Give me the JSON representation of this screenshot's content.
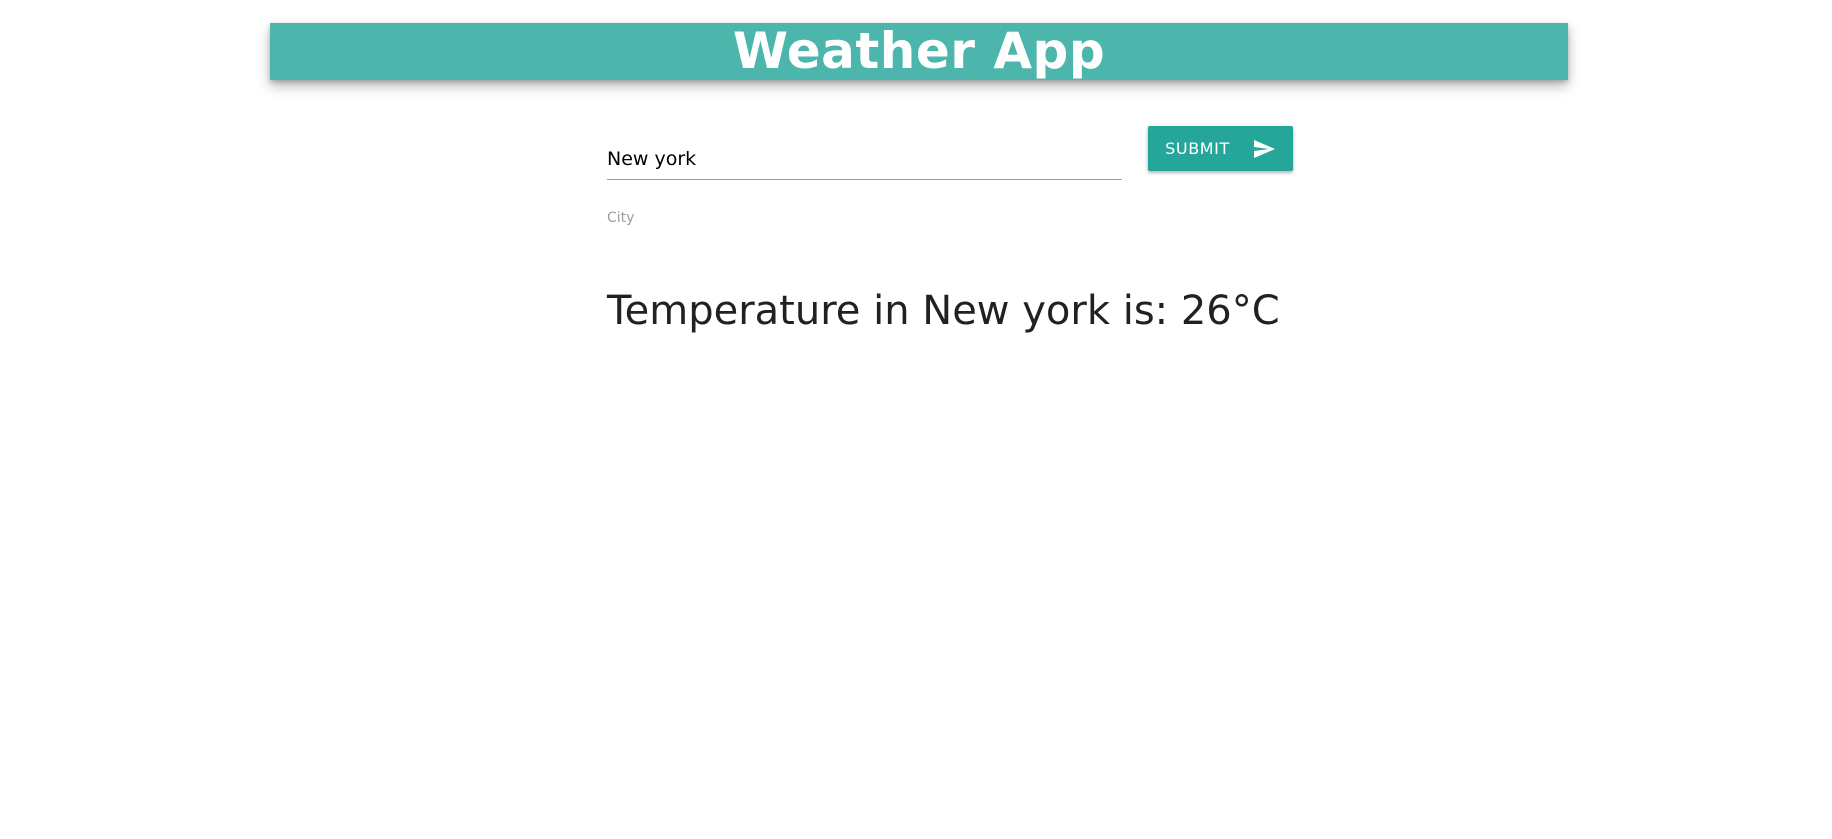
{
  "header": {
    "title": "Weather App",
    "background_color": "#4db6ac"
  },
  "form": {
    "city_value": "New york",
    "city_helper": "City",
    "submit_label": "SUBMIT",
    "submit_icon": "send-icon",
    "button_color": "#26a69a"
  },
  "result": {
    "text": "Temperature in New york is: 26°C"
  }
}
